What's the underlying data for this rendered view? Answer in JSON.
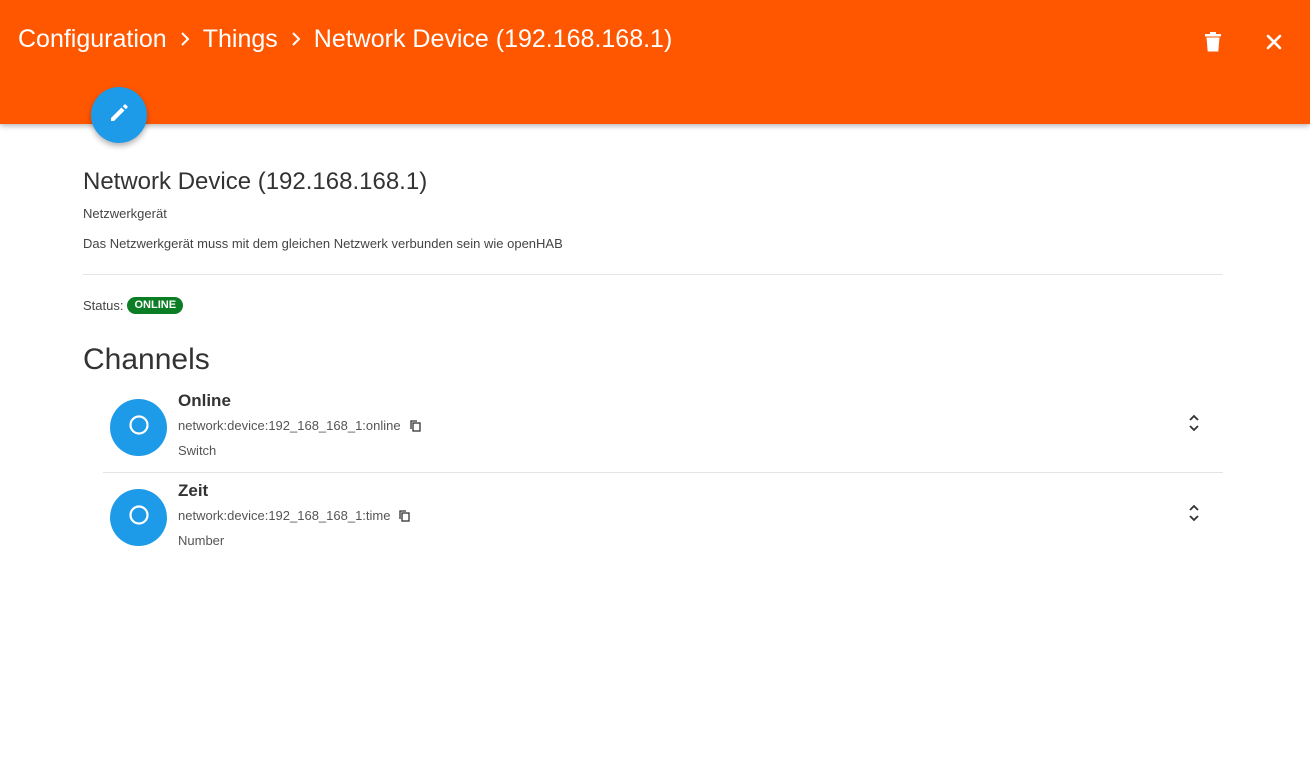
{
  "header": {
    "breadcrumb": [
      "Configuration",
      "Things",
      "Network Device (192.168.168.1)"
    ],
    "icons": {
      "separator": "chevron-right-icon",
      "delete": "trash-icon",
      "close": "close-icon",
      "edit": "pencil-icon"
    }
  },
  "thing": {
    "title": "Network Device (192.168.168.1)",
    "label": "Netzwerkgerät",
    "description": "Das Netzwerkgerät muss mit dem gleichen Netzwerk verbunden sein wie openHAB",
    "status_label": "Status:",
    "status": "ONLINE"
  },
  "channels": {
    "title": "Channels",
    "items": [
      {
        "name": "Online",
        "uid": "network:device:192_168_168_1:online",
        "type": "Switch"
      },
      {
        "name": "Zeit",
        "uid": "network:device:192_168_168_1:time",
        "type": "Number"
      }
    ]
  },
  "colors": {
    "header": "#ff5700",
    "accent": "#1e9be8",
    "status_online": "#0b7d25"
  }
}
